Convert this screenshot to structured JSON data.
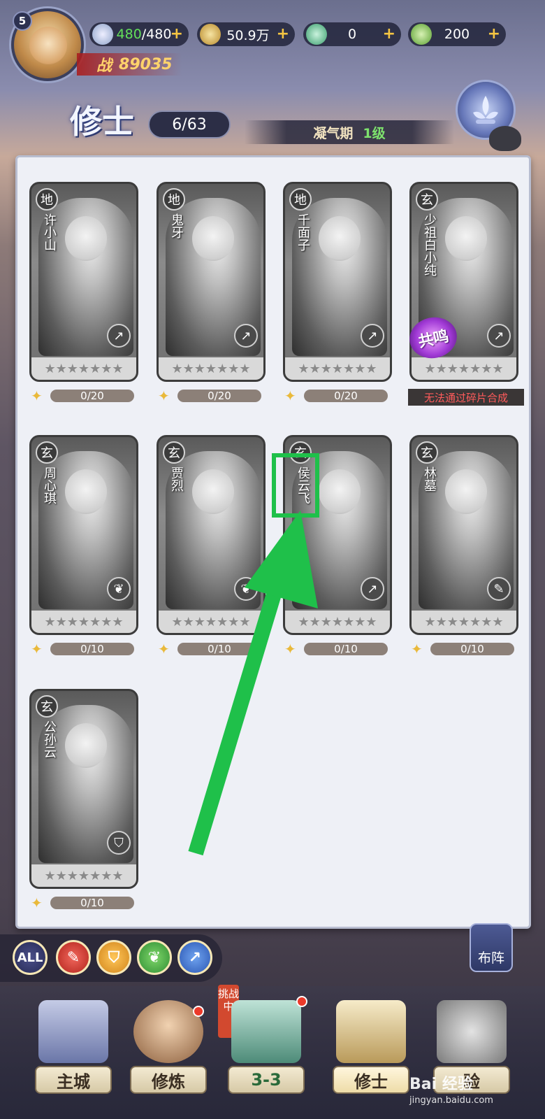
{
  "header": {
    "player_level": "5",
    "stamina": {
      "current": "480",
      "sep_max": "/480"
    },
    "coins": "50.9万",
    "jade": "0",
    "leaf": "200",
    "power_label": "战",
    "power_value": "89035",
    "page_title": "修士",
    "collected": "6/63",
    "realm_name": "凝气期",
    "realm_level": "1级"
  },
  "cards": [
    {
      "grade": "地",
      "name": "许小山",
      "fragments": "0/20",
      "type_icon": "↗"
    },
    {
      "grade": "地",
      "name": "鬼牙",
      "fragments": "0/20",
      "type_icon": "↗"
    },
    {
      "grade": "地",
      "name": "千面子",
      "fragments": "0/20",
      "type_icon": "↗"
    },
    {
      "grade": "玄",
      "name": "少祖白小纯",
      "fragments": "",
      "type_icon": "↗"
    },
    {
      "grade": "玄",
      "name": "周心琪",
      "fragments": "0/10",
      "type_icon": "❦"
    },
    {
      "grade": "玄",
      "name": "贾烈",
      "fragments": "0/10",
      "type_icon": "❦"
    },
    {
      "grade": "玄",
      "name": "侯云飞",
      "fragments": "0/10",
      "type_icon": "↗"
    },
    {
      "grade": "玄",
      "name": "林墓",
      "fragments": "0/10",
      "type_icon": "✎"
    },
    {
      "grade": "玄",
      "name": "公孙云",
      "fragments": "0/10",
      "type_icon": "⛉"
    }
  ],
  "stars": "★★★★★★★",
  "resonance_label": "共鸣",
  "cannot_synthesize": "无法通过碎片合成",
  "filters": [
    "ALL",
    "✎",
    "⛉",
    "❦",
    "↗"
  ],
  "deploy_label": "布阵",
  "nav": {
    "main_city": "主城",
    "cultivate": "修炼",
    "stage": "3-3",
    "cultivators": "修士",
    "experience": "验"
  },
  "challenge_tag": "挑战中",
  "watermark": {
    "text": "Bai 经验",
    "url": "jingyan.baidu.com"
  },
  "colors": {
    "highlight": "#1fc04a",
    "accent_gold": "#f5c542",
    "warn_red": "#ff5b5b"
  }
}
